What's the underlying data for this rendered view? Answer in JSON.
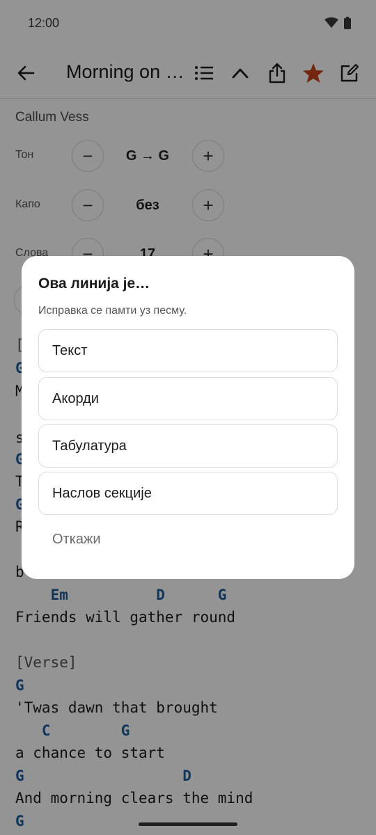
{
  "status": {
    "time": "12:00"
  },
  "app_bar": {
    "title": "Morning on t…",
    "icons": [
      "back-arrow-icon",
      "list-icon",
      "chevron-up-icon",
      "share-icon",
      "star-icon",
      "edit-icon"
    ],
    "star_color": "#c8441c"
  },
  "song": {
    "artist": "Callum Vess",
    "controls": [
      {
        "label": "Тон",
        "value": "G → G"
      },
      {
        "label": "Капо",
        "value": "без"
      },
      {
        "label": "Слова",
        "value": "17"
      }
    ]
  },
  "sheet": {
    "lines": [
      {
        "type": "section",
        "text": "["
      },
      {
        "type": "chord",
        "text": "G"
      },
      {
        "type": "lyric",
        "text": "M"
      },
      {
        "type": "lyric",
        "text": "s"
      },
      {
        "type": "chord",
        "text": "G"
      },
      {
        "type": "lyric",
        "text": "T"
      },
      {
        "type": "chord",
        "text": "G"
      },
      {
        "type": "lyric",
        "text": "R"
      },
      {
        "type": "lyric",
        "text": "b"
      },
      {
        "type": "chord",
        "text": "    Em          D      G"
      },
      {
        "type": "lyric",
        "text": "Friends will gather round"
      },
      {
        "type": "section",
        "text": "[Verse]"
      },
      {
        "type": "chord",
        "text": "G"
      },
      {
        "type": "lyric",
        "text": "'Twas dawn that brought"
      },
      {
        "type": "chord",
        "text": "   C        G"
      },
      {
        "type": "lyric",
        "text": "a chance to start"
      },
      {
        "type": "chord",
        "text": "G                  D"
      },
      {
        "type": "lyric",
        "text": "And morning clears the mind"
      },
      {
        "type": "chord",
        "text": "G"
      }
    ]
  },
  "dialog": {
    "title": "Ова линија је…",
    "subtitle": "Исправка се памти уз песму.",
    "options": [
      "Текст",
      "Акорди",
      "Табулатура",
      "Наслов секције"
    ],
    "cancel": "Откажи"
  }
}
